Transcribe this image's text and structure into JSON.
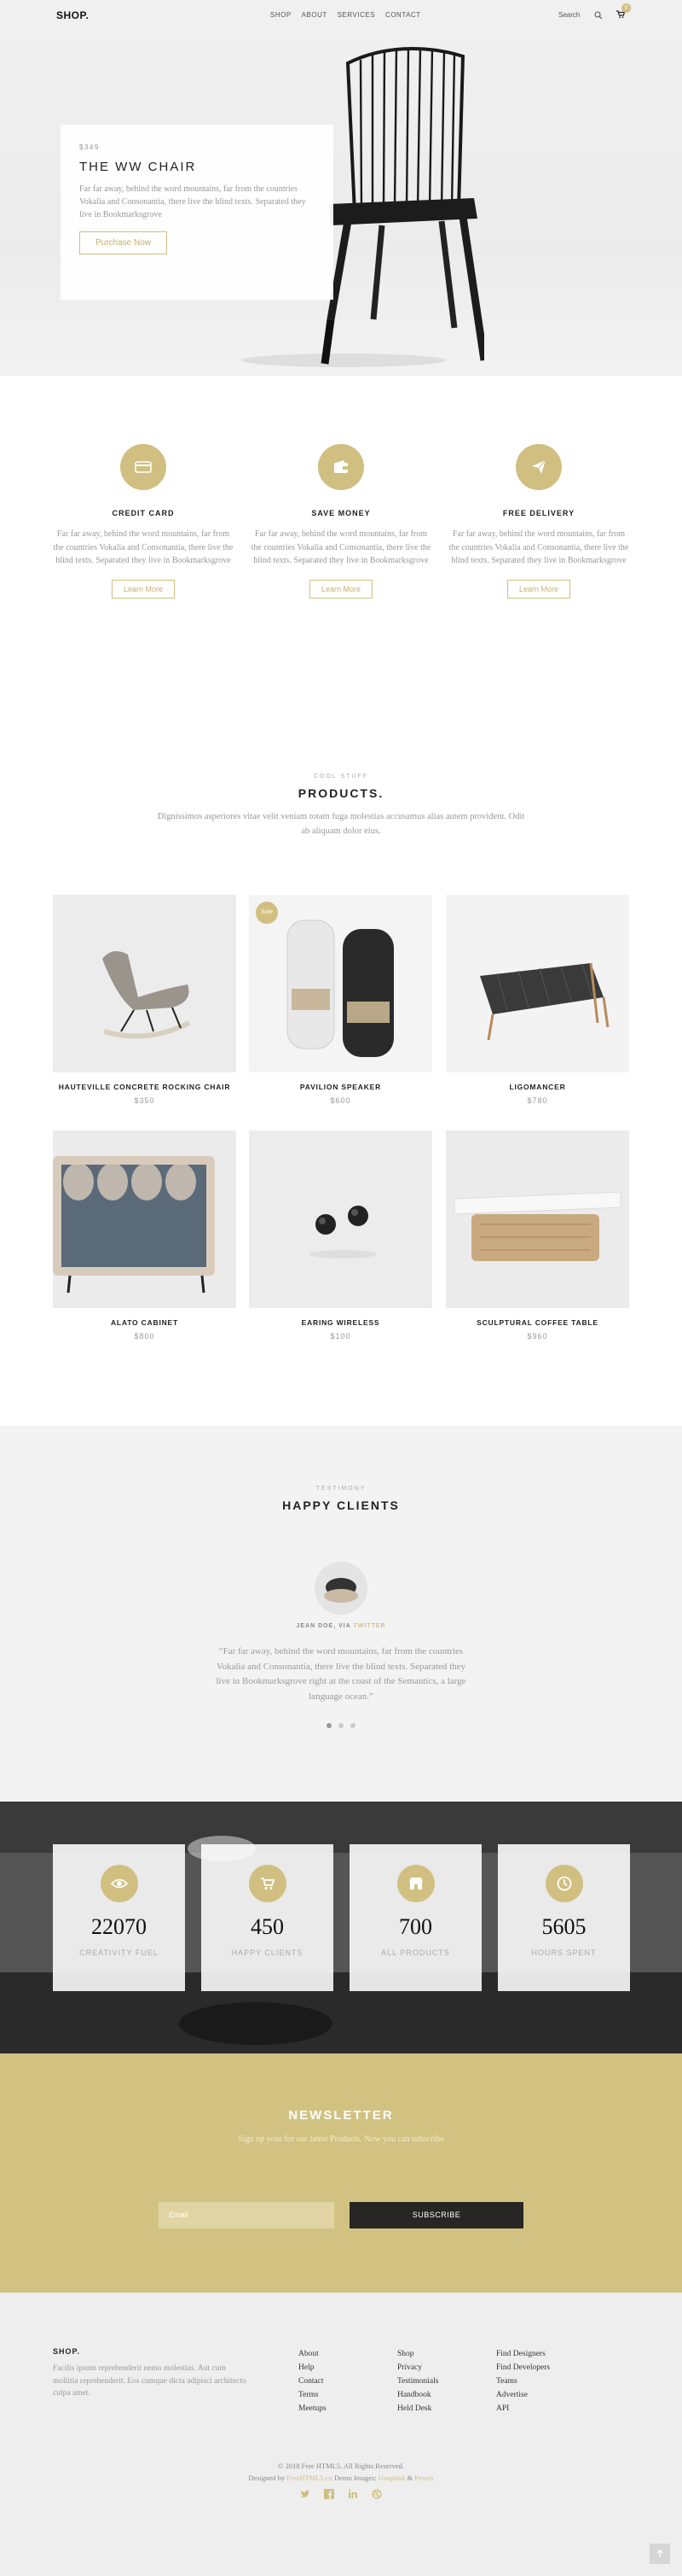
{
  "nav": {
    "logo": "SHOP.",
    "menu": [
      "SHOP",
      "ABOUT",
      "SERVICES",
      "CONTACT"
    ],
    "search_label": "Search",
    "cart_count": "0"
  },
  "hero": {
    "price": "$349",
    "title": "THE WW CHAIR",
    "text": "Far far away, behind the word mountains, far from the countries Vokalia and Consonantia, there live the blind texts. Separated they live in Bookmarksgrove",
    "button": "Purchase Now"
  },
  "features": [
    {
      "icon": "credit-card-icon",
      "title": "CREDIT CARD",
      "text": "Far far away, behind the word mountains, far from the countries Vokalia and Consonantia, there live the blind texts. Separated they live in Bookmarksgrove",
      "button": "Learn More"
    },
    {
      "icon": "wallet-icon",
      "title": "SAVE MONEY",
      "text": "Far far away, behind the word mountains, far from the countries Vokalia and Consonantia, there live the blind texts. Separated they live in Bookmarksgrove",
      "button": "Learn More"
    },
    {
      "icon": "paper-plane-icon",
      "title": "FREE DELIVERY",
      "text": "Far far away, behind the word mountains, far from the countries Vokalia and Consonantia, there live the blind texts. Separated they live in Bookmarksgrove",
      "button": "Learn More"
    }
  ],
  "products_section": {
    "eyebrow": "COOL STUFF",
    "title": "PRODUCTS.",
    "description": "Dignissimos asperiores vitae velit veniam totam fuga molestias accusamus alias autem provident. Odit ab aliquam dolor eius.",
    "sale_badge": "Sale",
    "items": [
      {
        "name": "HAUTEVILLE CONCRETE ROCKING CHAIR",
        "price": "$350"
      },
      {
        "name": "PAVILION SPEAKER",
        "price": "$600"
      },
      {
        "name": "LIGOMANCER",
        "price": "$780"
      },
      {
        "name": "ALATO CABINET",
        "price": "$800"
      },
      {
        "name": "EARING WIRELESS",
        "price": "$100"
      },
      {
        "name": "SCULPTURAL COFFEE TABLE",
        "price": "$960"
      }
    ]
  },
  "testimony": {
    "eyebrow": "TESTIMONY",
    "title": "HAPPY CLIENTS",
    "author": "JEAN DOE, VIA",
    "author_link": "TWITTER",
    "quote": "“Far far away, behind the word mountains, far from the countries Vokalia and Consonantia, there live the blind texts. Separated they live in Bookmarksgrove right at the coast of the Semantics, a large language ocean.”"
  },
  "counters": [
    {
      "icon": "eye-icon",
      "value": "22070",
      "label": "CREATIVITY FUEL"
    },
    {
      "icon": "cart-icon",
      "value": "450",
      "label": "HAPPY CLIENTS"
    },
    {
      "icon": "shop-icon",
      "value": "700",
      "label": "ALL PRODUCTS"
    },
    {
      "icon": "clock-icon",
      "value": "5605",
      "label": "HOURS SPENT"
    }
  ],
  "newsletter": {
    "title": "NEWSLETTER",
    "subtitle": "Sign up your for our latest Products. Now you can subscribe",
    "placeholder": "Email",
    "button": "SUBSCRIBE"
  },
  "footer": {
    "logo": "SHOP.",
    "description": "Facilis ipsum reprehenderit nemo molestias. Aut cum mollitia reprehenderit. Eos cumque dicta adipisci architecto culpa amet.",
    "col1": [
      "About",
      "Help",
      "Contact",
      "Terms",
      "Meetups"
    ],
    "col2": [
      "Shop",
      "Privacy",
      "Testimonials",
      "Handbook",
      "Held Desk"
    ],
    "col3": [
      "Find Designers",
      "Find Developers",
      "Teams",
      "Advertise",
      "API"
    ],
    "copyright": "© 2018 Free HTML5. All Rights Reserved.",
    "designed_by_prefix": "Designed by",
    "designer": "FreeHTML5.co",
    "demo_prefix": "Demo Images:",
    "demo1": "Unsplash",
    "demo_and": "&",
    "demo2": "Pexels",
    "social": [
      "twitter-icon",
      "facebook-icon",
      "linkedin-icon",
      "dribbble-icon"
    ]
  },
  "colors": {
    "accent": "#d0bf80",
    "dark": "#282624"
  }
}
